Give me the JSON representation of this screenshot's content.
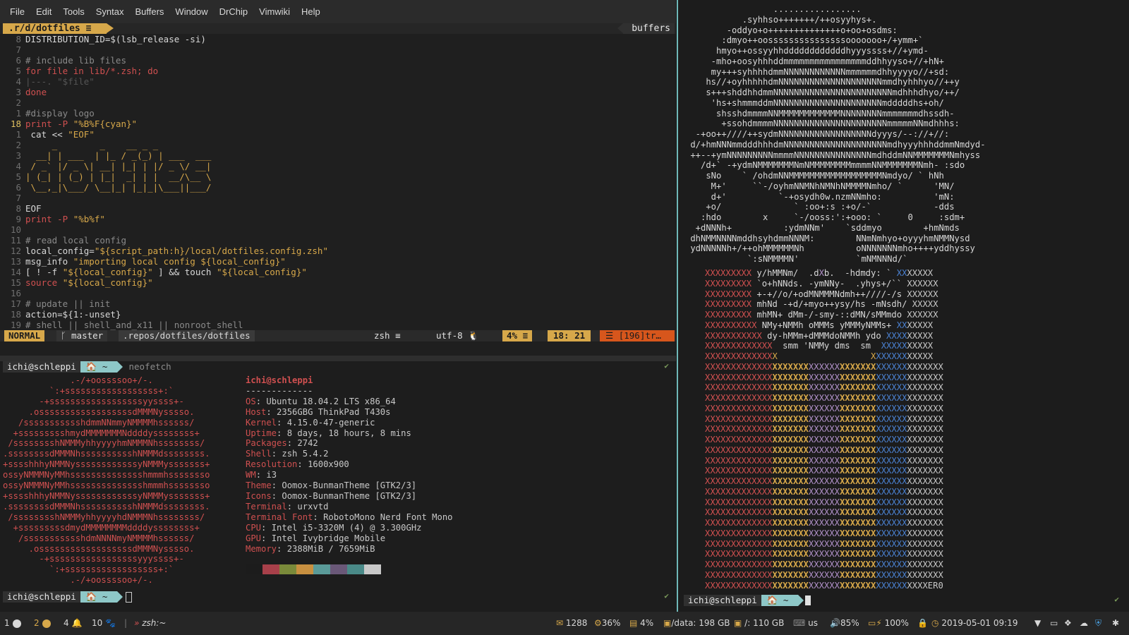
{
  "menu": [
    "File",
    "Edit",
    "Tools",
    "Syntax",
    "Buffers",
    "Window",
    "DrChip",
    "Vimwiki",
    "Help"
  ],
  "tabline": {
    "active": ".r/d/dotfiles ≡",
    "right": "buffers"
  },
  "code": [
    {
      "n": "8",
      "t": "DISTRIBUTION_ID=$(lsb_release -si)"
    },
    {
      "n": "7",
      "t": ""
    },
    {
      "n": "6",
      "t": "# include lib files"
    },
    {
      "n": "5",
      "t": "for file in lib/*.zsh; do"
    },
    {
      "n": "4",
      "t": "|---. \"$file\""
    },
    {
      "n": "3",
      "t": "done"
    },
    {
      "n": "2",
      "t": ""
    },
    {
      "n": "1",
      "t": "#display logo"
    },
    {
      "n": "18",
      "t": "print -P \"%B%F{cyan}\"",
      "cur": true
    },
    {
      "n": "1",
      "t": " cat << \"EOF\""
    },
    {
      "n": "2",
      "t": "     _        _    __ _ _"
    },
    {
      "n": "3",
      "t": "  __| | ___  | |_ / _(_) | ___  ___"
    },
    {
      "n": "4",
      "t": " / _` |/ _ \\| __| |_| | |/ _ \\/ __|"
    },
    {
      "n": "5",
      "t": "| (_| | (_) | |_|  _| | |  __/\\__ \\"
    },
    {
      "n": "6",
      "t": " \\__,_|\\___/ \\__|_| |_|_|\\___||___/"
    },
    {
      "n": "7",
      "t": ""
    },
    {
      "n": "8",
      "t": "EOF"
    },
    {
      "n": "9",
      "t": "print -P \"%b%f\""
    },
    {
      "n": "10",
      "t": ""
    },
    {
      "n": "11",
      "t": "# read local config"
    },
    {
      "n": "12",
      "t": "local_config=\"${script_path:h}/local/dotfiles.config.zsh\""
    },
    {
      "n": "13",
      "t": "msg_info \"importing local config ${local_config}\""
    },
    {
      "n": "14",
      "t": "[ ! -f \"${local_config}\" ] && touch \"${local_config}\""
    },
    {
      "n": "15",
      "t": "source \"${local_config}\""
    },
    {
      "n": "16",
      "t": ""
    },
    {
      "n": "17",
      "t": "# update || init"
    },
    {
      "n": "18",
      "t": "action=${1:-unset}"
    },
    {
      "n": "19",
      "t": "# shell || shell_and_x11 || nonroot_shell"
    }
  ],
  "statusline": {
    "mode": "NORMAL",
    "branch": "ᚴ master",
    "path": ".repos/dotfiles/dotfiles",
    "filetype": "zsh ≡",
    "encoding": "utf-8 🐧",
    "percent": "4% ≡",
    "position": "18: 21",
    "warning": "☰ [196]tr…"
  },
  "term_left": {
    "user": "ichi@schleppi",
    "dir": "🏠 ~",
    "command": "neofetch",
    "ok": "✔",
    "logo": [
      "             .-/+oossssoo+/-.",
      "         `:+ssssssssssssssssss+:`",
      "       -+ssssssssssssssssssyyssss+-",
      "     .ossssssssssssssssssdMMMNysssso.",
      "   /ssssssssssshdmmNNmmyNMMMMhssssss/",
      "  +ssssssssshmydMMMMMMMNddddyssssssss+",
      " /sssssssshNMMMyhhyyyyhmNMMMNhssssssss/",
      ".ssssssssdMMMNhsssssssssshNMMMdssssssss.",
      "+sssshhhyNMMNyssssssssssssyNMMMysssssss+",
      "ossyNMMMNyMMhsssssssssssssshmmmhssssssso",
      "ossyNMMMNyMMhsssssssssssssshmmmhssssssso",
      "+sssshhhyNMMNyssssssssssssyNMMMysssssss+",
      ".ssssssssdMMMNhsssssssssshNMMMdssssssss.",
      " /sssssssshNMMMyhhyyyyhdNMMMNhssssssss/",
      "  +sssssssssdmydMMMMMMMMddddyssssssss+",
      "   /ssssssssssshdmNNNNmyNMMMMhssssss/",
      "     .ossssssssssssssssssdMMMNysssso.",
      "       -+sssssssssssssssssyyyssss+-",
      "         `:+ssssssssssssssssss+:`",
      "             .-/+oossssoo+/-."
    ],
    "info_title": "ichi@schleppi",
    "info_sep": "-------------",
    "info": [
      {
        "k": "OS",
        "v": "Ubuntu 18.04.2 LTS x86_64"
      },
      {
        "k": "Host",
        "v": "2356GBG ThinkPad T430s"
      },
      {
        "k": "Kernel",
        "v": "4.15.0-47-generic"
      },
      {
        "k": "Uptime",
        "v": "8 days, 18 hours, 8 mins"
      },
      {
        "k": "Packages",
        "v": "2742"
      },
      {
        "k": "Shell",
        "v": "zsh 5.4.2"
      },
      {
        "k": "Resolution",
        "v": "1600x900"
      },
      {
        "k": "WM",
        "v": "i3"
      },
      {
        "k": "Theme",
        "v": "Oomox-BunmanTheme [GTK2/3]"
      },
      {
        "k": "Icons",
        "v": "Oomox-BunmanTheme [GTK2/3]"
      },
      {
        "k": "Terminal",
        "v": "urxvtd"
      },
      {
        "k": "Terminal Font",
        "v": "RobotoMono Nerd Font Mono"
      },
      {
        "k": "CPU",
        "v": "Intel i5-3320M (4) @ 3.300GHz"
      },
      {
        "k": "GPU",
        "v": "Intel Ivybridge Mobile"
      },
      {
        "k": "Memory",
        "v": "2388MiB / 7659MiB"
      }
    ],
    "swatch_colors": [
      "#1c1c1c",
      "#a8404a",
      "#7a8a3a",
      "#c89040",
      "#5a9a98",
      "#6a5878",
      "#4a8a88",
      "#c8c8c8"
    ]
  },
  "term_right": {
    "art": [
      "                 .................",
      "           .syhhso+++++++/++osyyhys+.",
      "        -oddyo+o++++++++++++++o+oo+osdms:",
      "       :dmyo++oosssssssssssssssooooooo+/+ymm+`",
      "      hmyo++ossyyhhddddddddddddhyyyssss+//+ymd-",
      "     -mho+oosyhhhddmmmmmmmmmmmmmmmmddhhyyso+//+hN+",
      "     my+++syhhhhdmmNNNNNNNNNNNNmmmmmmdhhyyyyo//+sd:",
      "    hs//+oyhhhhhdmNNNNNNNNNNNNNNNNNNNNmmdhyhhhyo//++y",
      "    s+++shddhhdmmNNNNNNNNNNNNNNNNNNNNNNNmdhhhdhyo/++/",
      "     'hs+shmmmddmNNNNNNNNNNNNNNNNNNNNNmdddddhs+oh/",
      "      shsshdmmmmNNMMMMMMMMMMMMNNNNNNNNmmmmmmmdhssdh-",
      "       +ssohdmmmmNNNNNNNNNNNNNNNNNNNNNNmmmmmNNmdhhhs:",
      "  -+oo++////++sydmNNNNNNNNNNNNNNNNNNdyyys/--://+//:",
      " d/+hmNNNmmdddhhhdmNNNNNNNNNNNNNNNNNNNNmdhyyyhhhddmmNmdyd-",
      " ++--+ymNNNNNNNNNmmmmNNNNNNNNNNNNNNNmdhddmNNMMMMMMMNmhyss",
      "   /d+` -+ydmNMMMMMMMNmNMMMMMMMMmmmmNNMMMMMMMNmh- :sdo",
      "    sNo    ` /ohdmNNMMMMMMMMMMMMMMMMMMNmdyo/ ` hNh",
      "     M+'     ``-/oyhmNNMNhNMNhNMMMMNmho/ `      'MN/",
      "     d+'          `-+osydh0w.nzmNNmho:          'mN:",
      "    +o/              ` :oo+:s :+o/-`            -dds",
      "   :hdo        x     `-/ooss:':+ooo: `     0     :sdm+",
      "  +dNNNh+          :ydmNNm'    `sddmyo        +hmNmds",
      " dhNMMNNNNmddhsyhdmmNNNM:        NNmNmhyo+oyyyhmNMMNysd",
      " ydNNNNNh+/++ohMMMMMMNh          oNNNNNNNmho++++yddhyssy",
      "            `:sNMMMMN'           `mNMNNNd/`"
    ],
    "xgrid": [
      "XXXXXXXXX y/hMMNm/  .dXb.  -hdmdy: ` XXXXXXX",
      "XXXXXXXXX `o+hNNds. -ymNNy-  .yhys+/`` XXXXXX",
      "XXXXXXXXX +-+//o/+odMNMMMNdmh++////-/s XXXXXX",
      "XXXXXXXXX mhNd -+d/+myo++ysy/hs -mNsdh/ XXXXX",
      "XXXXXXXXX mhMN+ dMm-/-smy-::dMN/sMMmdo XXXXXX",
      "XXXXXXXXXX NMy+NMMh oMMMs yMMMyNMMs+ XXXXXXX",
      "XXXXXXXXXXX dy-hMMm+dMMMdoNMMh ydo XXXXXXXXX",
      "XXXXXXXXXXXXX  smm 'NMMy dms  sm  XXXXXXXXXX",
      "XXXXXXXXXXXXXX                  XXXXXXXXXXXX"
    ],
    "grid_rows": 21,
    "grid_last": "XXXXXXXXXXXXXXXXXXXXXXXXXXXXXXXXXXXXXXXXXXXER0",
    "user": "ichi@schleppi",
    "dir": "🏠 ~",
    "ok": "✔"
  },
  "bar": {
    "ws1": "1",
    "ws2": "2",
    "ws4": "4",
    "ws10": "10",
    "sep": "|",
    "title": "zsh:~",
    "mail": "1288",
    "cpu": "36%",
    "mem": "4%",
    "disk_data": "/data: 198 GB",
    "disk_root": "/: 110 GB",
    "kbd": "us",
    "volume": "85%",
    "battery": "100%",
    "datetime": "2019-05-01  09:19"
  },
  "colors": {
    "accent": "#d7a84a",
    "cyan": "#8ec8c8",
    "red": "#d05050",
    "orange": "#d7561c"
  }
}
